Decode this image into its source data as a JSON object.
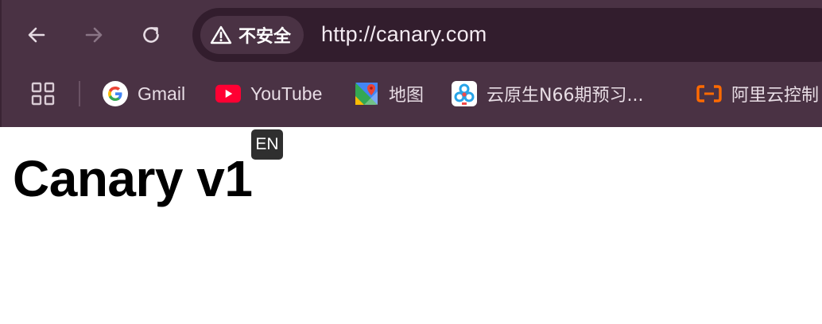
{
  "browser": {
    "nav": {
      "back_icon": "arrow-left-icon",
      "forward_icon": "arrow-right-icon",
      "reload_icon": "reload-icon"
    },
    "omnibox": {
      "security_label": "不安全",
      "security_icon": "warning-triangle-icon",
      "url": "http://canary.com"
    },
    "colors": {
      "frame": "#4a3244",
      "omnibox": "#321d2d",
      "text": "#f3eaf1"
    }
  },
  "bookmarks": {
    "apps_icon": "apps-grid-icon",
    "items": [
      {
        "label": "Gmail",
        "icon": "google-icon"
      },
      {
        "label": "YouTube",
        "icon": "youtube-icon"
      },
      {
        "label": "地图",
        "icon": "google-maps-icon"
      },
      {
        "label": "云原生N66期预习...",
        "icon": "cloud-app-icon"
      },
      {
        "label": "阿里云控制",
        "icon": "aliyun-icon"
      }
    ]
  },
  "page": {
    "heading": "Canary v1",
    "ime_indicator": "EN"
  }
}
